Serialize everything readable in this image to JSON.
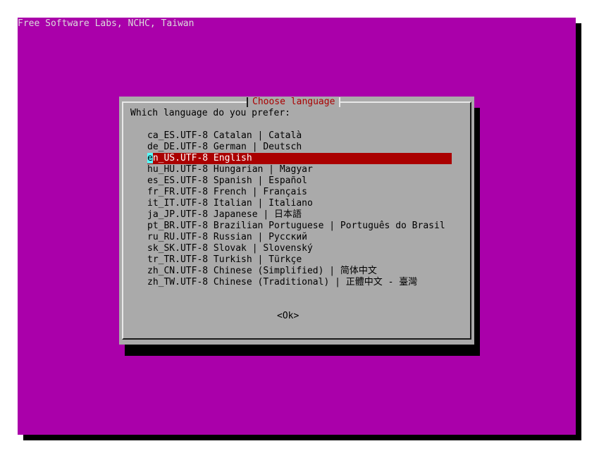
{
  "backtitle": "Free Software Labs, NCHC, Taiwan",
  "dialog": {
    "title": "Choose language",
    "prompt": "Which language do you prefer:",
    "ok_label": "<Ok>",
    "selected_index": 2
  },
  "languages": [
    "ca_ES.UTF-8 Catalan | Català",
    "de_DE.UTF-8 German | Deutsch",
    "en_US.UTF-8 English",
    "hu_HU.UTF-8 Hungarian | Magyar",
    "es_ES.UTF-8 Spanish | Español",
    "fr_FR.UTF-8 French | Français",
    "it_IT.UTF-8 Italian | Italiano",
    "ja_JP.UTF-8 Japanese | 日本語",
    "pt_BR.UTF-8 Brazilian Portuguese | Português do Brasil",
    "ru_RU.UTF-8 Russian | Русский",
    "sk_SK.UTF-8 Slovak | Slovenský",
    "tr_TR.UTF-8 Turkish | Türkçe",
    "zh_CN.UTF-8 Chinese (Simplified) | 简体中文",
    "zh_TW.UTF-8 Chinese (Traditional) | 正體中文 - 臺灣"
  ],
  "colors": {
    "screen_bg": "#aa00aa",
    "dialog_bg": "#aaaaaa",
    "title_fg": "#aa0000",
    "selected_bg": "#aa0000",
    "selected_fg": "#ffffff",
    "cursor_bg": "#55ffff"
  }
}
